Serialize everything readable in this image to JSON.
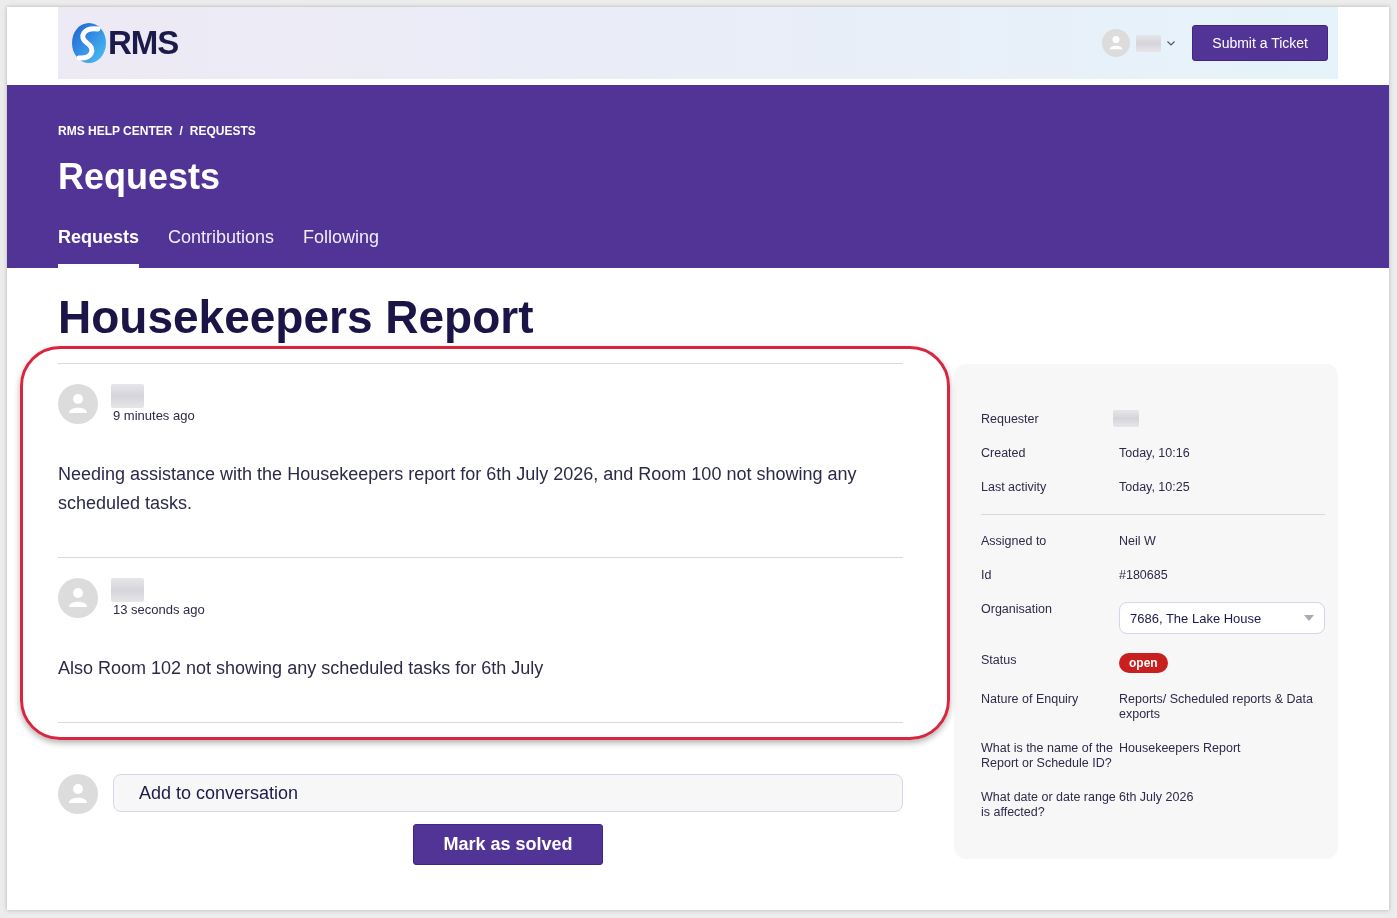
{
  "header": {
    "logo": {
      "text": "RMS"
    },
    "user_menu": {
      "name_hidden": true
    },
    "submit_button": "Submit a Ticket"
  },
  "breadcrumb": {
    "items": [
      "RMS HELP CENTER",
      "REQUESTS"
    ],
    "separator": "/"
  },
  "page_title": "Requests",
  "tabs": [
    {
      "label": "Requests",
      "selected": true
    },
    {
      "label": "Contributions",
      "selected": false
    },
    {
      "label": "Following",
      "selected": false
    }
  ],
  "request": {
    "title": "Housekeepers Report",
    "conversation": {
      "highlighted": true,
      "comments": [
        {
          "author_hidden": true,
          "time": "9 minutes ago",
          "body": "Needing assistance with the Housekeepers report for 6th July 2026, and Room 100 not showing any scheduled tasks."
        },
        {
          "author_hidden": true,
          "time": "13 seconds ago",
          "body": "Also Room 102 not showing any scheduled tasks for 6th July"
        }
      ]
    },
    "reply": {
      "placeholder": "Add to conversation"
    },
    "solve_button": "Mark as solved"
  },
  "details": {
    "sections": [
      {
        "fields": [
          {
            "kind": "redacted",
            "label": "Requester"
          },
          {
            "kind": "text",
            "label": "Created",
            "value": "Today, 10:16"
          },
          {
            "kind": "text",
            "label": "Last activity",
            "value": "Today, 10:25"
          }
        ]
      },
      {
        "fields": [
          {
            "kind": "text",
            "label": "Assigned to",
            "value": "Neil W"
          },
          {
            "kind": "text",
            "label": "Id",
            "value": "#180685"
          },
          {
            "kind": "select",
            "label": "Organisation",
            "value": "7686, The Lake House"
          },
          {
            "kind": "badge",
            "label": "Status",
            "value": "open",
            "color": "#c8201e"
          },
          {
            "kind": "text",
            "label": "Nature of Enquiry",
            "value": "Reports/ Scheduled reports & Data exports"
          },
          {
            "kind": "text",
            "label": "What is the name of the Report or Schedule ID?",
            "value": "Housekeepers Report"
          },
          {
            "kind": "text",
            "label": "What date or date range is affected?",
            "value": "6th July 2026"
          }
        ]
      }
    ]
  }
}
